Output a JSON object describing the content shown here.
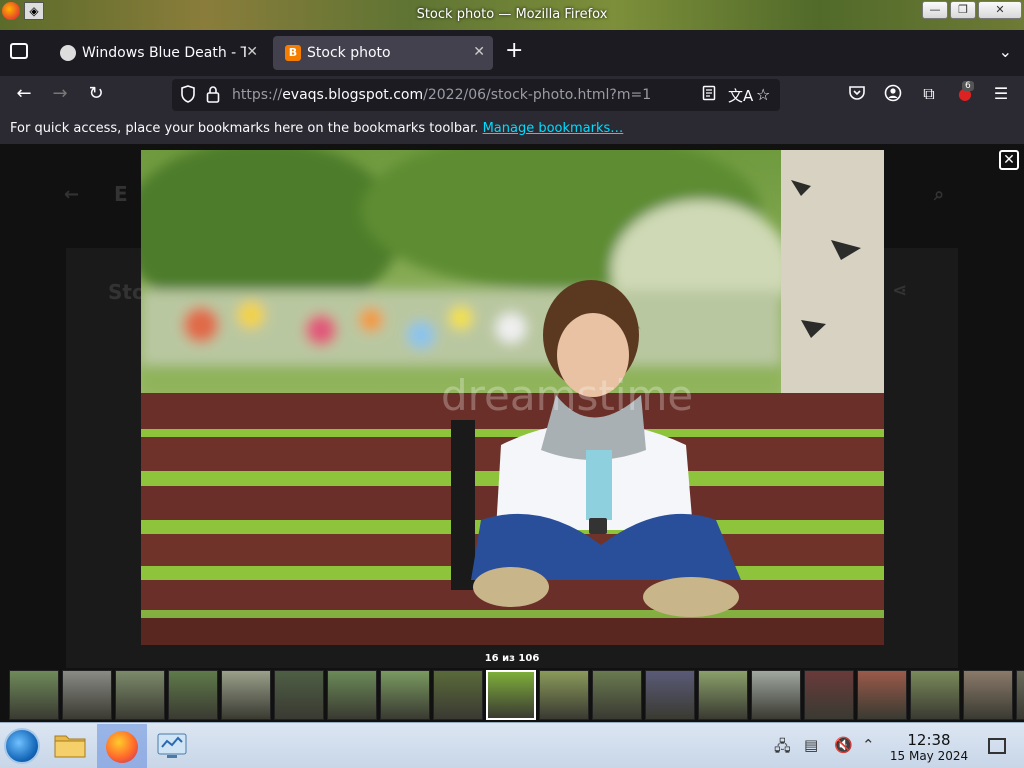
{
  "window": {
    "title": "Stock photo — Mozilla Firefox",
    "minimize": "—",
    "maximize": "❐",
    "close": "✕",
    "launcher_glyph": "◈"
  },
  "tabs": [
    {
      "label": "Windows Blue Death - Te",
      "icon": "ghost-icon",
      "close": "✕"
    },
    {
      "label": "Stock photo",
      "icon": "blogger-icon",
      "close": "✕",
      "active": true
    }
  ],
  "tabstrip": {
    "new_tab": "+",
    "list_tabs": "⌄"
  },
  "nav": {
    "back": "←",
    "forward": "→",
    "reload": "↻",
    "url_prefix": "https://",
    "url_host": "evaqs.blogspot.com",
    "url_path": "/2022/06/stock-photo.html?m=1",
    "extension_badge": "6"
  },
  "bookmarks_bar": {
    "text": "For quick access, place your bookmarks here on the bookmarks toolbar. ",
    "link": "Manage bookmarks…"
  },
  "lightbox": {
    "close": "✕",
    "counter": "16 из 106",
    "watermark": "dreamstime",
    "total_thumbnails_visible": 20,
    "selected_thumbnail_index": 9
  },
  "page_behind": {
    "title_fragment": "Sto",
    "header_fragment": "E"
  },
  "taskbar": {
    "time": "12:38",
    "date": "15 May 2024"
  },
  "colors": {
    "tab_active": "#42414d",
    "toolbar": "#2b2a33",
    "link": "#00ddff",
    "taskbar": "#dce6f2"
  }
}
